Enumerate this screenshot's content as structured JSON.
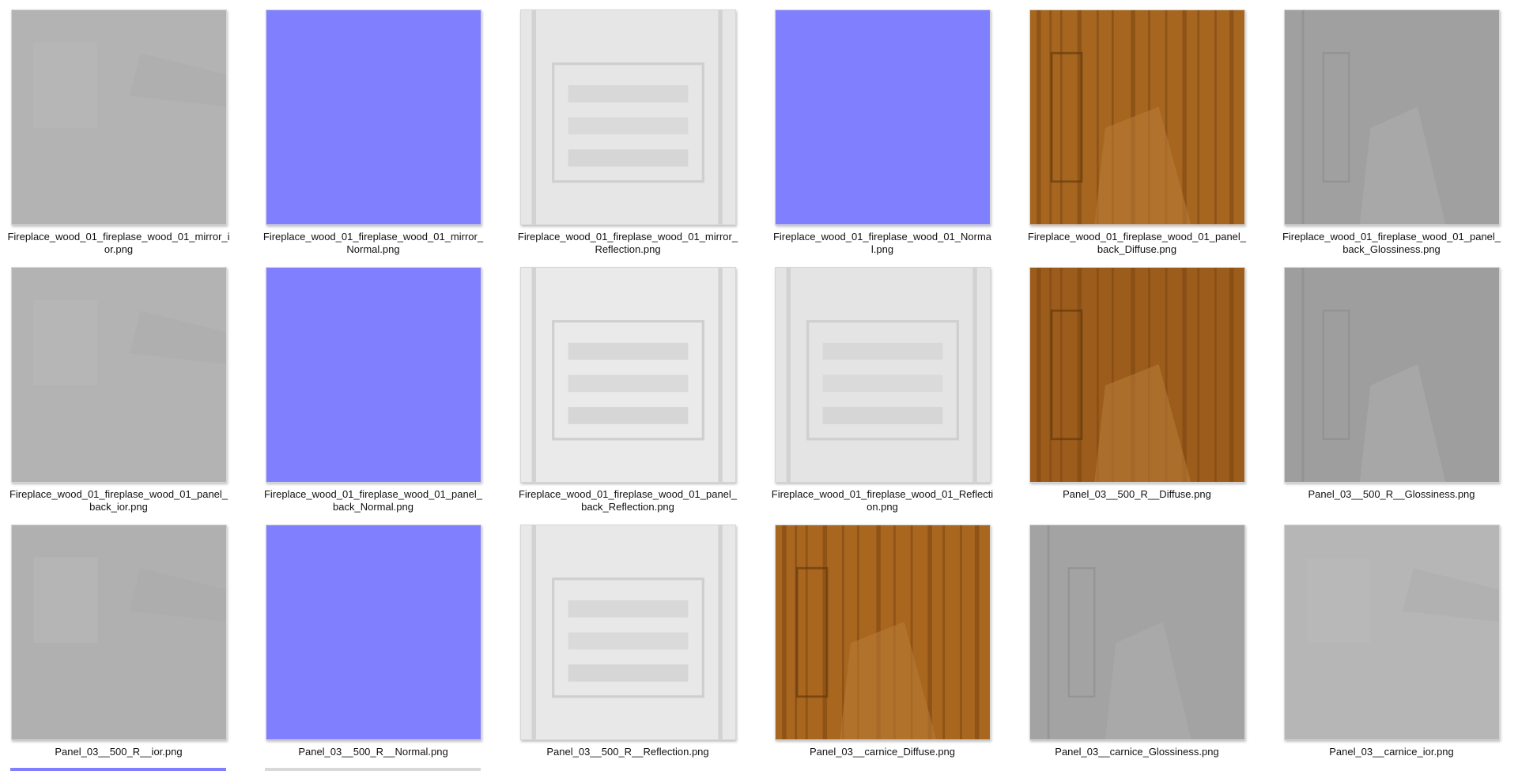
{
  "files": [
    {
      "name": "Fireplace_wood_01_fireplase_wood_01_mirror_ior.png",
      "kind": "gray-ior",
      "color": "#b3b3b3"
    },
    {
      "name": "Fireplace_wood_01_fireplase_wood_01_mirror_Normal.png",
      "kind": "normal",
      "color": "#8080ff"
    },
    {
      "name": "Fireplace_wood_01_fireplase_wood_01_mirror_Reflection.png",
      "kind": "reflection",
      "color": "#e6e6e6"
    },
    {
      "name": "Fireplace_wood_01_fireplase_wood_01_Normal.png",
      "kind": "normal",
      "color": "#8080ff"
    },
    {
      "name": "Fireplace_wood_01_fireplase_wood_01_panel_back_Diffuse.png",
      "kind": "wood",
      "color": "#a6661f"
    },
    {
      "name": "Fireplace_wood_01_fireplase_wood_01_panel_back_Glossiness.png",
      "kind": "gray-gloss",
      "color": "#a0a0a0"
    },
    {
      "name": "Fireplace_wood_01_fireplase_wood_01_panel_back_ior.png",
      "kind": "gray-ior",
      "color": "#b3b3b3"
    },
    {
      "name": "Fireplace_wood_01_fireplase_wood_01_panel_back_Normal.png",
      "kind": "normal",
      "color": "#8080ff"
    },
    {
      "name": "Fireplace_wood_01_fireplase_wood_01_panel_back_Reflection.png",
      "kind": "reflection",
      "color": "#eaeaea"
    },
    {
      "name": "Fireplace_wood_01_fireplase_wood_01_Reflection.png",
      "kind": "reflection",
      "color": "#e4e4e4"
    },
    {
      "name": "Panel_03__500_R__Diffuse.png",
      "kind": "wood",
      "color": "#9c5d1c"
    },
    {
      "name": "Panel_03__500_R__Glossiness.png",
      "kind": "gray-gloss",
      "color": "#9e9e9e"
    },
    {
      "name": "Panel_03__500_R__ior.png",
      "kind": "gray-ior",
      "color": "#b0b0b0"
    },
    {
      "name": "Panel_03__500_R__Normal.png",
      "kind": "normal",
      "color": "#8080ff"
    },
    {
      "name": "Panel_03__500_R__Reflection.png",
      "kind": "reflection",
      "color": "#e8e8e8"
    },
    {
      "name": "Panel_03__carnice_Diffuse.png",
      "kind": "wood",
      "color": "#a8661f"
    },
    {
      "name": "Panel_03__carnice_Glossiness.png",
      "kind": "gray-gloss",
      "color": "#a3a3a3"
    },
    {
      "name": "Panel_03__carnice_ior.png",
      "kind": "gray-ior",
      "color": "#b6b6b6"
    }
  ],
  "partial_row_colors": [
    "#8080ff",
    "#d9d9d9",
    "#ffffff",
    "#ffffff",
    "#ffffff",
    "#ffffff"
  ]
}
